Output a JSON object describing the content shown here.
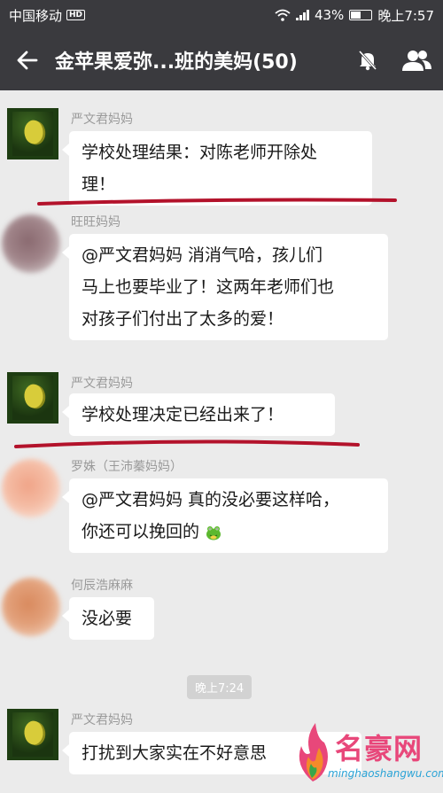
{
  "status_bar": {
    "carrier": "中国移动",
    "hd_badge": "HD",
    "battery": "43%",
    "time": "晚上7:57",
    "icons": [
      "wifi-icon",
      "signal-icon",
      "battery-icon"
    ]
  },
  "header": {
    "title": "金苹果爱弥...班的美妈(50)",
    "icons": [
      "back-arrow-icon",
      "mute-bell-icon",
      "group-members-icon"
    ]
  },
  "messages": [
    {
      "sender": "严文君妈妈",
      "text_lines": [
        "学校处理结果：对陈老师开除处",
        "理！"
      ],
      "avatar": "leaf"
    },
    {
      "sender": "旺旺妈妈",
      "text_lines": [
        "@严文君妈妈  消消气哈，孩儿们",
        "马上也要毕业了！这两年老师们也",
        "对孩子们付出了太多的爱！"
      ],
      "avatar": "blur-brown"
    },
    {
      "sender": "严文君妈妈",
      "text_lines": [
        "学校处理决定已经出来了！"
      ],
      "avatar": "leaf"
    },
    {
      "sender": "罗姝（王沛蓁妈妈）",
      "text_lines": [
        "@严文君妈妈  真的没必要这样哈，",
        "你还可以挽回的"
      ],
      "avatar": "blur-peach",
      "emoji": "frog-emoji-icon"
    },
    {
      "sender": "何辰浩麻麻",
      "text_lines": [
        "没必要"
      ],
      "avatar": "blur-orange"
    },
    {
      "sender": "严文君妈妈",
      "text_lines": [
        "打扰到大家实在不好意思"
      ],
      "avatar": "leaf"
    }
  ],
  "time_divider": "晚上7:24",
  "watermark": {
    "name": "名豪网",
    "url": "minghaoshangwu.com"
  },
  "colors": {
    "header_bg": "#3a3a3e",
    "chat_bg": "#ebebeb",
    "bubble_bg": "#ffffff",
    "sender_text": "#9a9a9a",
    "underline": "#b3122b"
  }
}
